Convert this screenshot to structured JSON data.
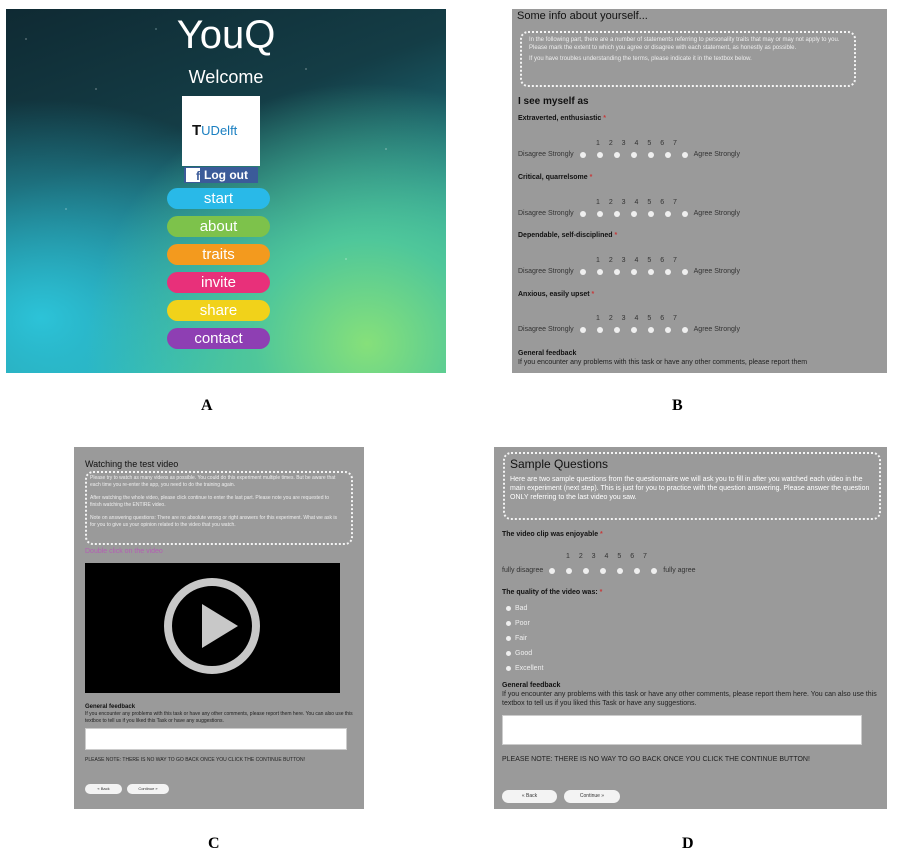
{
  "panel_labels": {
    "a": "A",
    "b": "B",
    "c": "C",
    "d": "D"
  },
  "panel_a": {
    "app_title": "YouQ",
    "welcome": "Welcome",
    "logo_text_prefix": "T",
    "logo_text": "UDelft",
    "logout_label": "Log out",
    "menu": [
      {
        "label": "start",
        "color": "#29b9e8"
      },
      {
        "label": "about",
        "color": "#7dc24b"
      },
      {
        "label": "traits",
        "color": "#f39a1e"
      },
      {
        "label": "invite",
        "color": "#e8307a"
      },
      {
        "label": "share",
        "color": "#f1d21a"
      },
      {
        "label": "contact",
        "color": "#8e3fb3"
      }
    ]
  },
  "panel_b": {
    "title": "Some info about yourself...",
    "intro_1": "In the following part, there are a number of statements referring to personality traits that may or may not apply to you. Please mark the extent to which you agree or disagree with each statement, as honestly as possible.",
    "intro_2": "If you have troubles understanding the terms, please indicate it in the textbox below.",
    "see_myself": "I see myself as",
    "scale_numbers": "1 2 3 4 5 6 7",
    "left_anchor": "Disagree Strongly",
    "right_anchor": "Agree Strongly",
    "items": [
      {
        "label": "Extraverted, enthusiastic"
      },
      {
        "label": "Critical, quarrelsome"
      },
      {
        "label": "Dependable, self-disciplined"
      },
      {
        "label": "Anxious, easily upset"
      }
    ],
    "feedback_title": "General feedback",
    "feedback_body": "If you encounter any problems with this task or have any other comments, please report them"
  },
  "panel_c": {
    "title": "Watching the test video",
    "p1": "Please try to watch as many videos as possible. You could do this experiment multiple times. But be aware that each time you re-enter the app, you need to do the training again.",
    "p2": "After watching the whole video, please click continue to enter the last part. Please note you are requested to finish watching the ENTIRE video.",
    "p3": "Note on answering questions: There are no absolute wrong or right answers for this experiment. What we ask is for you to give us your opinion related to the video that you watch.",
    "double_click": "Double click on the video",
    "feedback_title": "General feedback",
    "feedback_body": "If you encounter any problems with this task or have any other comments, please report them here. You can also use this textbox to tell us if you liked this Task or have any suggestions.",
    "note": "PLEASE NOTE: THERE IS NO WAY TO GO BACK ONCE YOU CLICK THE CONTINUE BUTTON!",
    "back": "« Back",
    "continue": "Continue »"
  },
  "panel_d": {
    "title": "Sample Questions",
    "intro": "Here are two sample questions from the questionnaire we will ask you to fill in after you watched each video in the main experiment (next step). This is just for you to practice with the question answering. Please answer the question ONLY referring to the last video you saw.",
    "q1": "The video clip was enjoyable",
    "scale_numbers": "1 2 3 4 5 6 7",
    "left_anchor": "fully disagree",
    "right_anchor": "fully agree",
    "q2": "The quality of the video was:",
    "options": [
      "Bad",
      "Poor",
      "Fair",
      "Good",
      "Excellent"
    ],
    "feedback_title": "General feedback",
    "feedback_body": "If you encounter any problems with this task or have any other comments, please report them here. You can also use this textbox to tell us if you liked this Task or have any suggestions.",
    "note": "PLEASE NOTE: THERE IS NO WAY TO GO BACK ONCE YOU CLICK THE CONTINUE BUTTON!",
    "back": "« Back",
    "continue": "Continue »"
  }
}
